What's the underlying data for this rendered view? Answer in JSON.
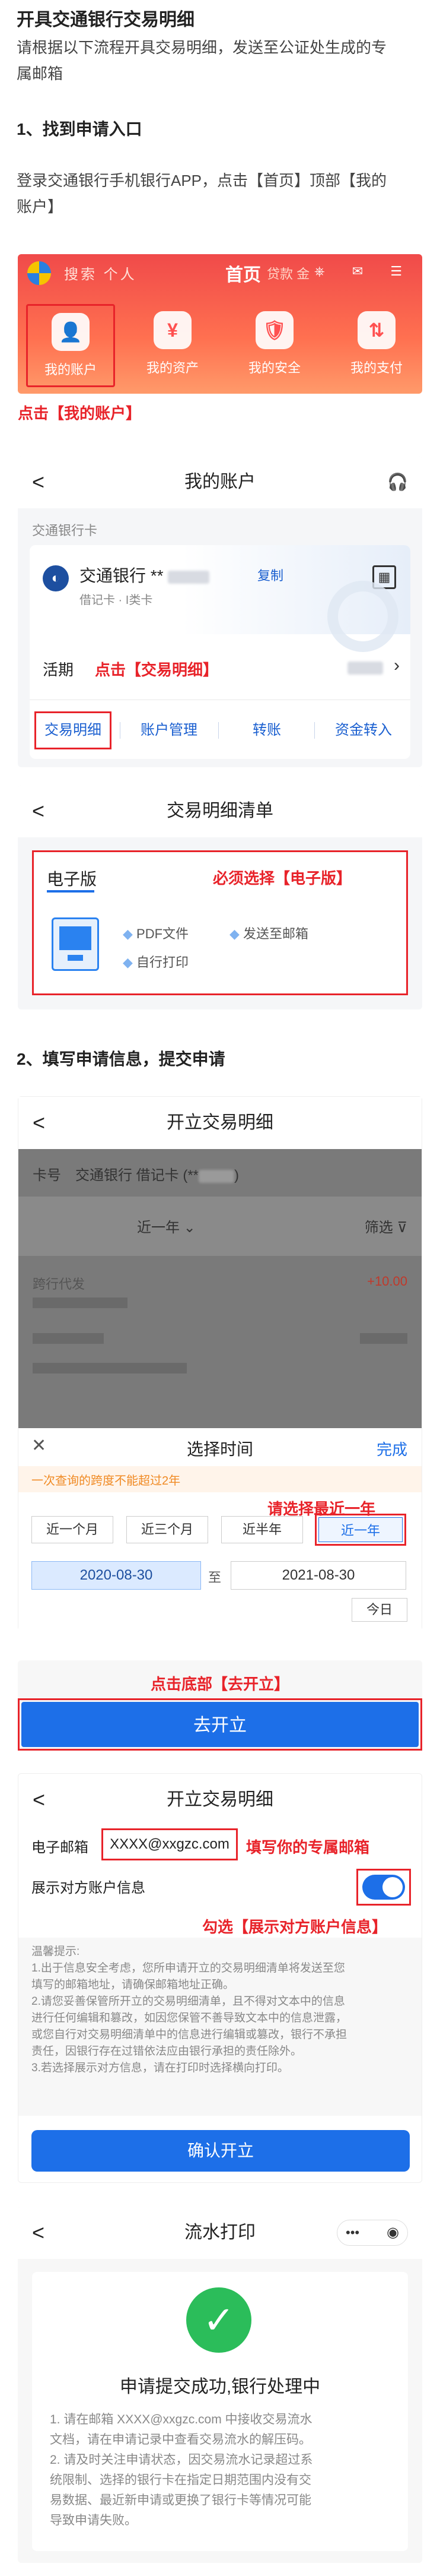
{
  "title": "开具交通银行交易明细",
  "intro": [
    "请根据以下流程开具交易明细，发送至公证处生成的专",
    "属邮箱"
  ],
  "step1": {
    "heading": "1、找到申请入口",
    "text": [
      "登录交通银行手机银行APP，点击【首页】顶部【我的",
      "账户】"
    ],
    "banner": {
      "search": "搜索 个人",
      "home": "首页",
      "tip": "贷款 金",
      "top_icons": "⎈ ✉ ☰",
      "items": [
        "我的账户",
        "我的资产",
        "我的安全",
        "我的支付"
      ],
      "item_icons": [
        "👤",
        "¥",
        "🛡",
        "⇅"
      ]
    },
    "annotation": "点击【我的账户】",
    "account_screen": {
      "title": "我的账户",
      "card_type_label": "交通银行卡",
      "bank_name": "交通银行 **",
      "copy": "复制",
      "card_sub": "借记卡 · I类卡",
      "live_label": "活期",
      "annotation": "点击【交易明细】",
      "actions": [
        "交易明细",
        "账户管理",
        "转账",
        "资金转入"
      ]
    },
    "detail_list_screen": {
      "title": "交易明细清单",
      "option_title": "电子版",
      "annotation": "必须选择【电子版】",
      "features": [
        "PDF文件",
        "发送至邮箱",
        "自行打印"
      ]
    }
  },
  "step2": {
    "heading": "2、填写申请信息，提交申请",
    "open_screen": {
      "title": "开立交易明细",
      "card_label": "卡号",
      "card_value": "交通银行 借记卡 (**",
      "filter_period": "近一年",
      "filter": "筛选",
      "row_name": "跨行代发",
      "row_amount": "+10.00",
      "picker_title": "选择时间",
      "picker_done": "完成",
      "picker_warning": "一次查询的跨度不能超过2年",
      "picker_annotation": "请选择最近一年",
      "periods": [
        "近一个月",
        "近三个月",
        "近半年",
        "近一年"
      ],
      "date_from": "2020-08-30",
      "date_to_sep": "至",
      "date_to": "2021-08-30",
      "today": "今日"
    },
    "bottom_annotation": "点击底部【去开立】",
    "go_button": "去开立",
    "email_screen": {
      "title": "开立交易明细",
      "email_label": "电子邮箱",
      "email_value": "XXXX@xxgzc.com",
      "email_annotation": "填写你的专属邮箱",
      "show_label": "展示对方账户信息",
      "show_annotation": "勾选【展示对方账户信息】",
      "tips": [
        "温馨提示:",
        "1.出于信息安全考虑，您所申请开立的交易明细清单将发送至您",
        "填写的邮箱地址，请确保邮箱地址正确。",
        "2.请您妥善保管所开立的交易明细清单，且不得对文本中的信息",
        "进行任何编辑和篡改，如因您保管不善导致文本中的信息泄露，",
        "或您自行对交易明细清单中的信息进行编辑或篡改，银行不承担",
        "责任，因银行存在过错依法应由银行承担的责任除外。",
        "3.若选择展示对方信息，请在打印时选择横向打印。"
      ],
      "confirm": "确认开立"
    },
    "result_screen": {
      "title": "流水打印",
      "menu": "•••",
      "status": "申请提交成功,银行处理中",
      "notes": [
        "1. 请在邮箱  XXXX@xxgzc.com  中接收交易流水",
        "文档，请在申请记录中查看交易流水的解压码。",
        "2. 请及时关注申请状态，因交易流水记录超过系",
        "统限制、选择的银行卡在指定日期范围内没有交",
        "易数据、最近新申请或更换了银行卡等情况可能",
        "导致申请失败。"
      ]
    }
  }
}
